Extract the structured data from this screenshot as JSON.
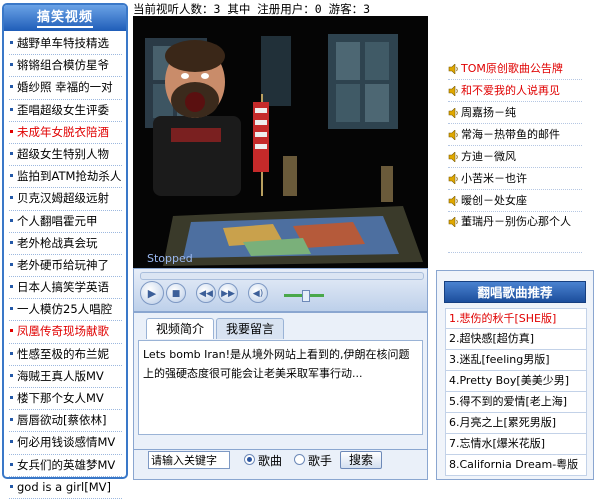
{
  "left_panel": {
    "title": "搞笑视频",
    "items": [
      {
        "label": "越野单车特技精选",
        "highlight": false
      },
      {
        "label": "锵锵组合模仿星爷",
        "highlight": false
      },
      {
        "label": "婚纱照 幸福的一对",
        "highlight": false
      },
      {
        "label": "歪唱超级女生评委",
        "highlight": false
      },
      {
        "label": "未成年女脱衣陪酒",
        "highlight": true
      },
      {
        "label": "超级女生特别人物",
        "highlight": false
      },
      {
        "label": "监拍到ATM抢劫杀人",
        "highlight": false
      },
      {
        "label": "贝克汉姆超级远射",
        "highlight": false
      },
      {
        "label": "个人翻唱霍元甲",
        "highlight": false
      },
      {
        "label": "老外枪战真会玩",
        "highlight": false
      },
      {
        "label": "老外硬币给玩神了",
        "highlight": false
      },
      {
        "label": "日本人搞笑学英语",
        "highlight": false
      },
      {
        "label": "一人模仿25人唱腔",
        "highlight": false
      },
      {
        "label": "凤凰传奇现场献歌",
        "highlight": true
      },
      {
        "label": "性感至极的布兰妮",
        "highlight": false
      },
      {
        "label": "海贼王真人版MV",
        "highlight": false
      },
      {
        "label": "楼下那个女人MV",
        "highlight": false
      },
      {
        "label": "唇唇欲动[蔡依林]",
        "highlight": false
      },
      {
        "label": "何必用钱谈感情MV",
        "highlight": false
      },
      {
        "label": "女兵们的英雄梦MV",
        "highlight": false
      },
      {
        "label": "god is a girl[MV]",
        "highlight": false
      }
    ]
  },
  "status": {
    "text": "当前视听人数：3 其中 注册用户：0 游客：3"
  },
  "player": {
    "state": "Stopped"
  },
  "tabs": [
    {
      "label": "视频简介",
      "active": true
    },
    {
      "label": "我要留言",
      "active": false
    }
  ],
  "description": "Lets bomb Iran!是从境外网站上看到的,伊朗在核问题上的强硬态度很可能会让老美采取军事行动...",
  "search": {
    "placeholder": "请输入关键字",
    "options": [
      {
        "label": "歌曲",
        "selected": true
      },
      {
        "label": "歌手",
        "selected": false
      }
    ],
    "button": "搜索"
  },
  "songs": [
    {
      "label": "TOM原创歌曲公告牌",
      "red": true
    },
    {
      "label": "和不爱我的人说再见",
      "red": true
    },
    {
      "label": "周嘉扬－纯",
      "red": false
    },
    {
      "label": "常海－热带鱼的邮件",
      "red": false
    },
    {
      "label": "方迪－微风",
      "red": false
    },
    {
      "label": "小苦米－也许",
      "red": false
    },
    {
      "label": "暧创－处女座",
      "red": false
    },
    {
      "label": "董瑞丹－别伤心那个人",
      "red": false
    }
  ],
  "recommend": {
    "title": "翻唱歌曲推荐",
    "items": [
      "1.悲伤的秋千[SHE版]",
      "2.超快感[超仿真]",
      "3.迷乱[feeling男版]",
      "4.Pretty Boy[美美少男]",
      "5.得不到的爱情[老上海]",
      "6.月亮之上[累死男版]",
      "7.忘情水[爆米花版]",
      "8.California Dream-粤版"
    ]
  },
  "colors": {
    "accent": "#3a78c8",
    "highlight": "#e00000"
  }
}
